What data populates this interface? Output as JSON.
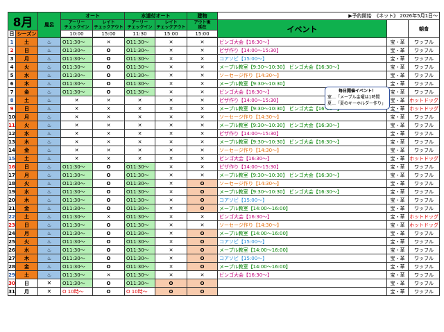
{
  "header": {
    "month": "8月",
    "col_day": "日",
    "col_season": "シーズン",
    "col_bath": "風呂",
    "auto_group": "オート",
    "water_group": "水道付オート",
    "cabin_group": "建物",
    "event_label": "イベント",
    "breakfast_label": "朝食",
    "notice": "▶予約開始　《ネット》 2026年5月1日～",
    "early_label": "アーリー",
    "late_label": "レイト",
    "checkin_label": "チェックイン",
    "checkout_label": "チェックアウト",
    "out_delay_label": "アウト後",
    "out_delay_label2": "延在",
    "auto_early_time": "10:00",
    "auto_late_time": "15:00",
    "water_early_time": "11:30",
    "water_late_time": "15:00",
    "cabin_time": "15:00"
  },
  "callout": {
    "title": "毎日開催イベント！",
    "line1": "室…「メープル金曜は1時間",
    "line2": "夏…「夏のキーホルダー作り」"
  },
  "colors": {
    "header_green": "#0fb14e",
    "season_orange": "#ef7d1b",
    "bath_blue": "#9dc3e6",
    "avail_green": "#b6f0b6",
    "salmon": "#f8cbad",
    "sat_blue": "#1f4e9b",
    "sun_red": "#e00000",
    "event_magenta": "#c00078",
    "event_orange": "#e36c09",
    "event_blue": "#1f8ad6",
    "event_green": "#008000"
  },
  "rows": [
    {
      "day": "1",
      "dow": "土",
      "type": "sat",
      "season": "peak",
      "bath": "♨",
      "auto_early": "O11:30～",
      "auto_late": "✕",
      "water_early": "O11:30～",
      "water_late": "✕",
      "cabin": "✕",
      "event": "ビンゴ大会【16:30～】",
      "event_color": "magenta",
      "tag": "宝・革",
      "breakfast": "ワッフル"
    },
    {
      "day": "2",
      "dow": "日",
      "type": "sun",
      "season": "peak",
      "bath": "♨",
      "auto_early": "O11:30～",
      "auto_late": "O",
      "water_early": "O11:30～",
      "water_late": "✕",
      "cabin": "✕",
      "event": "ピザ作り【14:00～15:30】",
      "event_color": "magenta",
      "tag": "宝・革",
      "breakfast": "ワッフル"
    },
    {
      "day": "3",
      "dow": "月",
      "type": "wd",
      "season": "peak",
      "bath": "♨",
      "auto_early": "O11:30～",
      "auto_late": "O",
      "water_early": "O11:30～",
      "water_late": "✕",
      "cabin": "✕",
      "event": "コアソビ【15:00～】",
      "event_color": "blue",
      "tag": "宝・革",
      "breakfast": "ワッフル"
    },
    {
      "day": "4",
      "dow": "火",
      "type": "wd",
      "season": "peak",
      "bath": "♨",
      "auto_early": "O11:30～",
      "auto_late": "O",
      "water_early": "O11:30～",
      "water_late": "✕",
      "cabin": "✕",
      "event": "メープル教室【9:30～10:30】 ビンゴ大会【16:30～】",
      "event_color": "green",
      "tag": "宝・革",
      "breakfast": "ワッフル"
    },
    {
      "day": "5",
      "dow": "水",
      "type": "wd",
      "season": "peak",
      "bath": "♨",
      "auto_early": "O11:30～",
      "auto_late": "O",
      "water_early": "O11:30～",
      "water_late": "✕",
      "cabin": "✕",
      "event": "ソーセージ作り【14:30～】",
      "event_color": "orange",
      "tag": "宝・革",
      "breakfast": "ワッフル"
    },
    {
      "day": "6",
      "dow": "木",
      "type": "wd",
      "season": "peak",
      "bath": "♨",
      "auto_early": "O11:30～",
      "auto_late": "O",
      "water_early": "O11:30～",
      "water_late": "✕",
      "cabin": "✕",
      "event": "メープル教室【9:30～10:30】",
      "event_color": "green",
      "tag": "宝・革",
      "breakfast": "ワッフル"
    },
    {
      "day": "7",
      "dow": "金",
      "type": "wd",
      "season": "peak",
      "bath": "♨",
      "auto_early": "O11:30～",
      "auto_late": "O",
      "water_early": "O11:30～",
      "water_late": "✕",
      "cabin": "✕",
      "event": "ビンゴ大会【16:30～】",
      "event_color": "magenta",
      "tag": "宝・革",
      "breakfast": "ワッフル"
    },
    {
      "day": "8",
      "dow": "土",
      "type": "sat",
      "season": "peak",
      "bath": "♨",
      "auto_early": "✕",
      "auto_late": "✕",
      "water_early": "✕",
      "water_late": "✕",
      "cabin": "✕",
      "event": "ピザ作り【14:00～15:30】",
      "event_color": "magenta",
      "tag": "宝・革",
      "breakfast": "ホットドッグ"
    },
    {
      "day": "9",
      "dow": "日",
      "type": "sun",
      "season": "peak",
      "bath": "♨",
      "auto_early": "✕",
      "auto_late": "✕",
      "water_early": "✕",
      "water_late": "✕",
      "cabin": "✕",
      "event": "メープル教室【9:30～10:30】 ビンゴ大会【16:30～】",
      "event_color": "green",
      "tag": "宝・革",
      "breakfast": "ホットドッグ"
    },
    {
      "day": "10",
      "dow": "月",
      "type": "wd",
      "season": "peak",
      "bath": "♨",
      "auto_early": "✕",
      "auto_late": "✕",
      "water_early": "✕",
      "water_late": "✕",
      "cabin": "✕",
      "event": "ソーセージ作り【14:30～】",
      "event_color": "orange",
      "tag": "宝・革",
      "breakfast": "ワッフル"
    },
    {
      "day": "11",
      "dow": "火",
      "type": "wd-red",
      "season": "peak",
      "bath": "♨",
      "auto_early": "✕",
      "auto_late": "✕",
      "water_early": "✕",
      "water_late": "✕",
      "cabin": "✕",
      "event": "メープル教室【9:30～10:30】 ビンゴ大会【16:30～】",
      "event_color": "green",
      "tag": "宝・革",
      "breakfast": "ワッフル"
    },
    {
      "day": "12",
      "dow": "水",
      "type": "wd",
      "season": "peak",
      "bath": "♨",
      "auto_early": "✕",
      "auto_late": "✕",
      "water_early": "✕",
      "water_late": "✕",
      "cabin": "✕",
      "event": "ピザ作り【14:00～15:30】",
      "event_color": "magenta",
      "tag": "宝・革",
      "breakfast": "ワッフル"
    },
    {
      "day": "13",
      "dow": "木",
      "type": "wd",
      "season": "peak",
      "bath": "♨",
      "auto_early": "✕",
      "auto_late": "✕",
      "water_early": "✕",
      "water_late": "✕",
      "cabin": "✕",
      "event": "メープル教室【9:30～10:30】 ビンゴ大会【16:30～】",
      "event_color": "green",
      "tag": "宝・革",
      "breakfast": "ワッフル"
    },
    {
      "day": "14",
      "dow": "金",
      "type": "wd",
      "season": "peak",
      "bath": "♨",
      "auto_early": "✕",
      "auto_late": "✕",
      "water_early": "✕",
      "water_late": "✕",
      "cabin": "✕",
      "event": "ソーセージ作り【14:30～】",
      "event_color": "orange",
      "tag": "宝・革",
      "breakfast": "ワッフル"
    },
    {
      "day": "15",
      "dow": "土",
      "type": "sat",
      "season": "peak",
      "bath": "♨",
      "auto_early": "✕",
      "auto_late": "✕",
      "water_early": "✕",
      "water_late": "✕",
      "cabin": "✕",
      "event": "ビンゴ大会【16:30～】",
      "event_color": "magenta",
      "tag": "宝・革",
      "breakfast": "ホットドッグ"
    },
    {
      "day": "16",
      "dow": "日",
      "type": "sun",
      "season": "peak",
      "bath": "♨",
      "auto_early": "O11:30～",
      "auto_late": "O",
      "water_early": "O11:30～",
      "water_late": "✕",
      "cabin": "✕",
      "event": "ピザ作り【14:00～15:30】",
      "event_color": "magenta",
      "tag": "宝・革",
      "breakfast": "ワッフル"
    },
    {
      "day": "17",
      "dow": "月",
      "type": "wd",
      "season": "peak",
      "bath": "♨",
      "auto_early": "O11:30～",
      "auto_late": "O",
      "water_early": "O11:30～",
      "water_late": "✕",
      "cabin": "✕",
      "event": "メープル教室【9:30～10:30】 ビンゴ大会【16:30～】",
      "event_color": "green",
      "tag": "宝・革",
      "breakfast": "ワッフル"
    },
    {
      "day": "18",
      "dow": "火",
      "type": "wd",
      "season": "peak",
      "bath": "♨",
      "auto_early": "O11:30～",
      "auto_late": "O",
      "water_early": "O11:30～",
      "water_late": "✕",
      "cabin": "O",
      "event": "ソーセージ作り【14:30～】",
      "event_color": "orange",
      "tag": "宝・革",
      "breakfast": "ワッフル"
    },
    {
      "day": "19",
      "dow": "水",
      "type": "wd",
      "season": "peak",
      "bath": "♨",
      "auto_early": "O11:30～",
      "auto_late": "O",
      "water_early": "O11:30～",
      "water_late": "✕",
      "cabin": "O",
      "event": "メープル教室【9:30～10:30】 ビンゴ大会【16:30～】",
      "event_color": "green",
      "tag": "宝・革",
      "breakfast": "ワッフル"
    },
    {
      "day": "20",
      "dow": "木",
      "type": "wd",
      "season": "peak",
      "bath": "♨",
      "auto_early": "O11:30～",
      "auto_late": "O",
      "water_early": "O11:30～",
      "water_late": "✕",
      "cabin": "O",
      "event": "コアソビ【15:00～】",
      "event_color": "blue",
      "tag": "宝・革",
      "breakfast": "ワッフル"
    },
    {
      "day": "21",
      "dow": "金",
      "type": "wd",
      "season": "peak",
      "bath": "♨",
      "auto_early": "O11:30～",
      "auto_late": "O",
      "water_early": "O11:30～",
      "water_late": "✕",
      "cabin": "O",
      "event": "メープル教室【14:00～16:00】",
      "event_color": "green",
      "tag": "宝・革",
      "breakfast": "ワッフル"
    },
    {
      "day": "22",
      "dow": "土",
      "type": "sat",
      "season": "peak",
      "bath": "♨",
      "auto_early": "O11:30～",
      "auto_late": "✕",
      "water_early": "O11:30～",
      "water_late": "✕",
      "cabin": "✕",
      "event": "ビンゴ大会【16:30～】",
      "event_color": "magenta",
      "tag": "宝・革",
      "breakfast": "ホットドッグ"
    },
    {
      "day": "23",
      "dow": "日",
      "type": "sun",
      "season": "peak",
      "bath": "♨",
      "auto_early": "O11:30～",
      "auto_late": "O",
      "water_early": "O11:30～",
      "water_late": "✕",
      "cabin": "✕",
      "event": "ソーセージ作り【14:30～】",
      "event_color": "orange",
      "tag": "宝・革",
      "breakfast": "ホットドッグ"
    },
    {
      "day": "24",
      "dow": "月",
      "type": "wd",
      "season": "peak",
      "bath": "♨",
      "auto_early": "O11:30～",
      "auto_late": "O",
      "water_early": "O11:30～",
      "water_late": "✕",
      "cabin": "O",
      "event": "メープル教室【14:00～16:00】",
      "event_color": "green",
      "tag": "宝・革",
      "breakfast": "ワッフル"
    },
    {
      "day": "25",
      "dow": "火",
      "type": "wd",
      "season": "peak",
      "bath": "♨",
      "auto_early": "O11:30～",
      "auto_late": "O",
      "water_early": "O11:30～",
      "water_late": "✕",
      "cabin": "O",
      "event": "コアソビ【15:00～】",
      "event_color": "blue",
      "tag": "宝・革",
      "breakfast": "ワッフル"
    },
    {
      "day": "26",
      "dow": "水",
      "type": "wd",
      "season": "peak",
      "bath": "♨",
      "auto_early": "O11:30～",
      "auto_late": "O",
      "water_early": "O11:30～",
      "water_late": "✕",
      "cabin": "O",
      "event": "メープル教室【14:00～16:00】",
      "event_color": "green",
      "tag": "宝・革",
      "breakfast": "ワッフル"
    },
    {
      "day": "27",
      "dow": "木",
      "type": "wd",
      "season": "peak",
      "bath": "♨",
      "auto_early": "O11:30～",
      "auto_late": "O",
      "water_early": "O11:30～",
      "water_late": "✕",
      "cabin": "O",
      "event": "コアソビ【15:00～】",
      "event_color": "blue",
      "tag": "宝・革",
      "breakfast": "ワッフル"
    },
    {
      "day": "28",
      "dow": "金",
      "type": "wd",
      "season": "peak",
      "bath": "♨",
      "auto_early": "O11:30～",
      "auto_late": "O",
      "water_early": "O11:30～",
      "water_late": "✕",
      "cabin": "O",
      "event": "メープル教室【14:00～16:00】",
      "event_color": "green",
      "tag": "宝・革",
      "breakfast": "ワッフル"
    },
    {
      "day": "29",
      "dow": "土",
      "type": "sat",
      "season": "peak",
      "bath": "♨",
      "auto_early": "O11:30～",
      "auto_late": "✕",
      "water_early": "O11:30～",
      "water_late": "✕",
      "cabin": "✕",
      "event": "ビンゴ大会【16:30～】",
      "event_color": "magenta",
      "tag": "宝・革",
      "breakfast": "ワッフル"
    },
    {
      "day": "30",
      "dow": "日",
      "type": "sun",
      "season": "low",
      "bath": "✕",
      "auto_early": "O11:30～",
      "auto_late": "O",
      "water_early": "O11:30～",
      "water_late": "O",
      "cabin": "O",
      "event": "",
      "event_color": "magenta",
      "tag": "宝・革",
      "breakfast": "ワッフル"
    },
    {
      "day": "31",
      "dow": "月",
      "type": "wd",
      "season": "low",
      "bath": "✕",
      "auto_early": "O 10時～",
      "auto_late": "O",
      "water_early": "O 10時～",
      "water_late": "O",
      "cabin": "O",
      "event": "",
      "event_color": "magenta",
      "tag": "宝・革",
      "breakfast": "ワッフル"
    }
  ]
}
